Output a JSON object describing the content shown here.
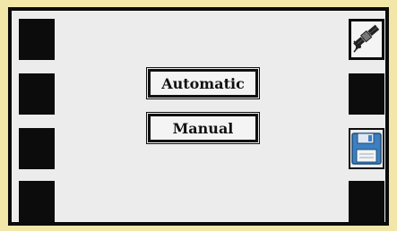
{
  "modes": {
    "automatic_label": "Automatic",
    "manual_label": "Manual"
  },
  "left_softkeys": [
    {
      "icon": "none"
    },
    {
      "icon": "none"
    },
    {
      "icon": "none"
    },
    {
      "icon": "none"
    }
  ],
  "right_softkeys": [
    {
      "icon": "satellite-icon"
    },
    {
      "icon": "none"
    },
    {
      "icon": "save-icon"
    },
    {
      "icon": "none"
    }
  ],
  "colors": {
    "bezel": "#f2e6a8",
    "screen": "#ececec",
    "softkey": "#0c0c0c",
    "save_icon_blue": "#3d7fbf"
  }
}
